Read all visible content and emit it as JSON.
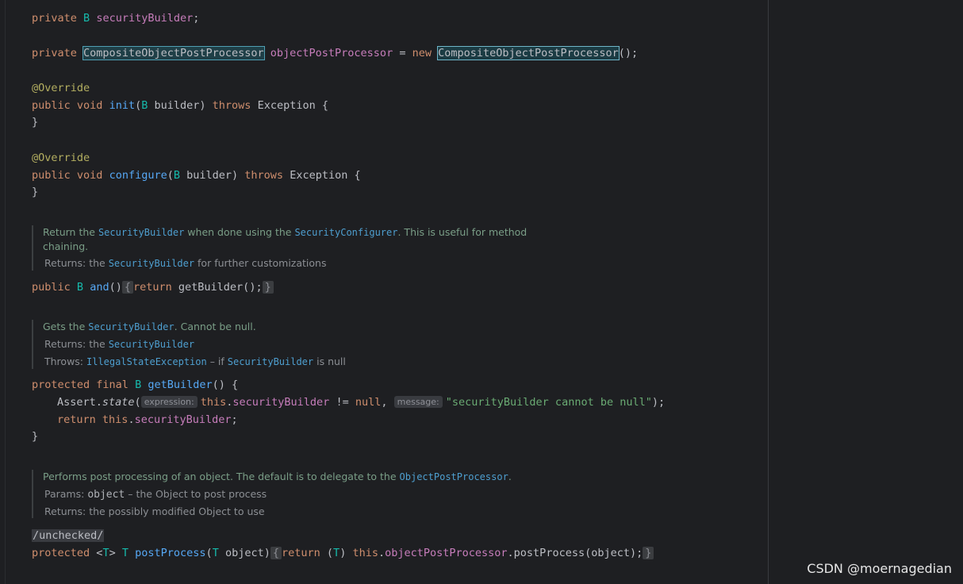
{
  "code": {
    "line1": {
      "private": "private",
      "type": "B",
      "field": "securityBuilder",
      "semi": ";"
    },
    "line2": {
      "private": "private",
      "type": "CompositeObjectPostProcessor",
      "name": "objectPostProcessor",
      "eq": " = ",
      "new": "new",
      "ctor": "CompositeObjectPostProcessor",
      "end": "();"
    },
    "init": {
      "annotation": "@Override",
      "public": "public",
      "void": "void",
      "name": "init",
      "open": "(",
      "type": "B",
      "param": " builder) ",
      "throws": "throws",
      "rest": " Exception {",
      "close": "}"
    },
    "configure": {
      "annotation": "@Override",
      "public": "public",
      "void": "void",
      "name": "configure",
      "open": "(",
      "type": "B",
      "param": " builder) ",
      "throws": "throws",
      "rest": " Exception {",
      "close": "}"
    },
    "and": {
      "public": "public",
      "type": "B",
      "name": "and",
      "parens": "()",
      "fold_open": "{",
      "return": "return",
      "body": " getBuilder();",
      "fold_close": "}"
    },
    "getBuilder": {
      "protected": "protected",
      "final": "final",
      "type": "B",
      "name": "getBuilder",
      "sig": "() {",
      "assert": "Assert.",
      "state": "state",
      "paren": "(",
      "hint1": "expression:",
      "this1": "this",
      "dot1": ".",
      "field1": "securityBuilder",
      "neq": " != ",
      "null": "null",
      "comma": ", ",
      "hint2": "message:",
      "msg": "\"securityBuilder cannot be null\"",
      "end": ");",
      "return": "return",
      "this2": "this",
      "dot2": ".",
      "field2": "securityBuilder",
      "semi": ";",
      "close": "}"
    },
    "postProcess": {
      "suppress": "/unchecked/",
      "protected": "protected",
      "gen_open": "<",
      "gen_T": "T",
      "gen_close": ">",
      "ret_T": "T",
      "name": "postProcess",
      "p_open": "(",
      "p_T": "T",
      "p_rest": " object)",
      "fold_open": "{",
      "return": "return",
      "cast_open": " (",
      "cast_T": "T",
      "cast_close": ") ",
      "this": "this",
      "dot": ".",
      "field": "objectPostProcessor",
      "call": ".postProcess(object);",
      "fold_close": "}"
    }
  },
  "docs": {
    "and": {
      "t1": "Return the ",
      "c1": "SecurityBuilder",
      "t2": " when done using the ",
      "c2": "SecurityConfigurer",
      "t3": ". This is useful for method",
      "t4": "chaining.",
      "ret_label": "Returns: ",
      "ret_t1": "the ",
      "ret_c": "SecurityBuilder",
      "ret_t2": " for further customizations"
    },
    "getBuilder": {
      "t1": "Gets the ",
      "c1": "SecurityBuilder",
      "t2": ". Cannot be null.",
      "ret_label": "Returns: ",
      "ret_t1": "the ",
      "ret_c": "SecurityBuilder",
      "throws_label": "Throws: ",
      "th_c1": "IllegalStateException",
      "th_t1": " – if ",
      "th_c2": "SecurityBuilder",
      "th_t2": " is null"
    },
    "postProcess": {
      "t1": "Performs post processing of an object. The default is to delegate to the ",
      "c1": "ObjectPostProcessor",
      "t2": ".",
      "params_label": "Params: ",
      "param_c": "object",
      "param_t": " – the Object to post process",
      "ret_label": "Returns: ",
      "ret_t": "the possibly modified Object to use"
    }
  },
  "watermark": "CSDN @moernagedian"
}
